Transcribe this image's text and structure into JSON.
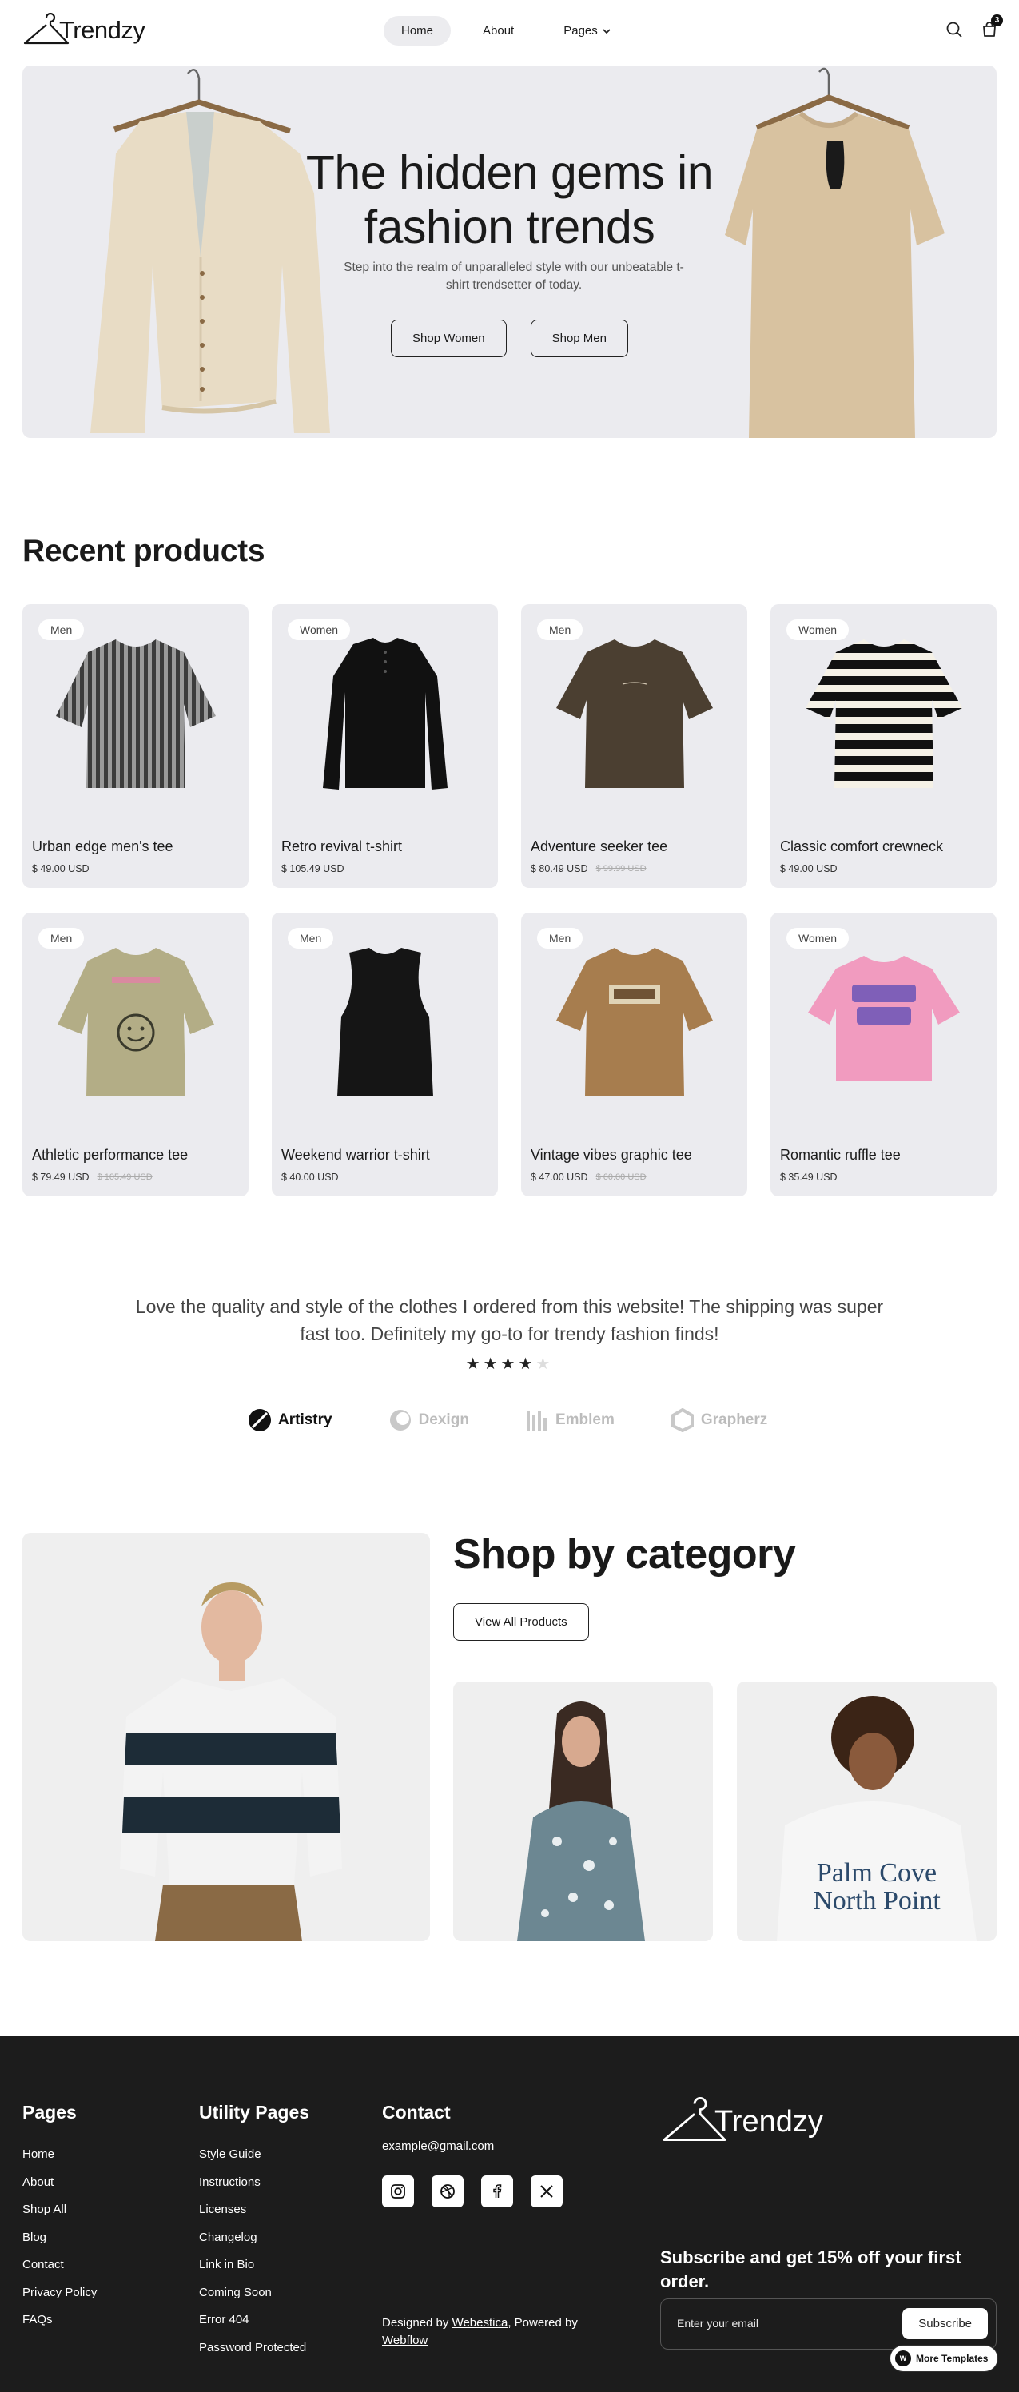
{
  "brand": {
    "name": "Trendzy"
  },
  "nav": {
    "links": [
      {
        "label": "Home",
        "active": true
      },
      {
        "label": "About"
      },
      {
        "label": "Pages",
        "has_dropdown": true
      }
    ],
    "cart_count": "3",
    "icons": [
      "search-icon",
      "cart-icon"
    ]
  },
  "hero": {
    "title_line1": "The hidden gems in",
    "title_line2": "fashion trends",
    "subtitle": "Step into the realm of unparalleled style with our unbeatable t-shirt trendsetter of today.",
    "btn_women": "Shop Women",
    "btn_men": "Shop Men"
  },
  "recent": {
    "title": "Recent products",
    "products": [
      {
        "tag": "Men",
        "name": "Urban edge men's tee",
        "price": "$ 49.00 USD",
        "old_price": ""
      },
      {
        "tag": "Women",
        "name": "Retro revival t-shirt",
        "price": "$ 105.49 USD",
        "old_price": ""
      },
      {
        "tag": "Men",
        "name": "Adventure seeker tee",
        "price": "$ 80.49 USD",
        "old_price": "$ 99.99 USD"
      },
      {
        "tag": "Women",
        "name": "Classic comfort crewneck",
        "price": "$ 49.00 USD",
        "old_price": ""
      },
      {
        "tag": "Men",
        "name": "Athletic performance tee",
        "price": "$ 79.49 USD",
        "old_price": "$ 105.49 USD"
      },
      {
        "tag": "Men",
        "name": "Weekend warrior t-shirt",
        "price": "$ 40.00 USD",
        "old_price": ""
      },
      {
        "tag": "Men",
        "name": "Vintage vibes graphic tee",
        "price": "$ 47.00 USD",
        "old_price": "$ 60.00 USD"
      },
      {
        "tag": "Women",
        "name": "Romantic ruffle tee",
        "price": "$ 35.49 USD",
        "old_price": ""
      }
    ]
  },
  "testimonial": {
    "quote": "Love the quality and style of the clothes I ordered from this website! The shipping was super fast too. Definitely my go-to for trendy fashion finds!",
    "rating": 4,
    "max_rating": 5,
    "brands": [
      "Artistry",
      "Dexign",
      "Emblem",
      "Grapherz"
    ]
  },
  "category": {
    "title": "Shop by category",
    "button": "View All Products"
  },
  "footer": {
    "pages_head": "Pages",
    "pages": [
      "Home",
      "About",
      "Shop All",
      "Blog",
      "Contact",
      "Privacy Policy",
      "FAQs"
    ],
    "utility_head": "Utility Pages",
    "utility": [
      "Style Guide",
      "Instructions",
      "Licenses",
      "Changelog",
      "Link in Bio",
      "Coming Soon",
      "Error 404",
      "Password Protected"
    ],
    "contact_head": "Contact",
    "email": "example@gmail.com",
    "socials": [
      "instagram-icon",
      "dribbble-icon",
      "facebook-icon",
      "x-icon"
    ],
    "credit_prefix": "Designed by ",
    "credit_designer": "Webestica",
    "credit_mid": ", Powered by ",
    "credit_platform": "Webflow",
    "subscribe_title": "Subscribe and get 15% off your first order.",
    "subscribe_placeholder": "Enter your email",
    "subscribe_button": "Subscribe",
    "more_templates": "More Templates"
  }
}
